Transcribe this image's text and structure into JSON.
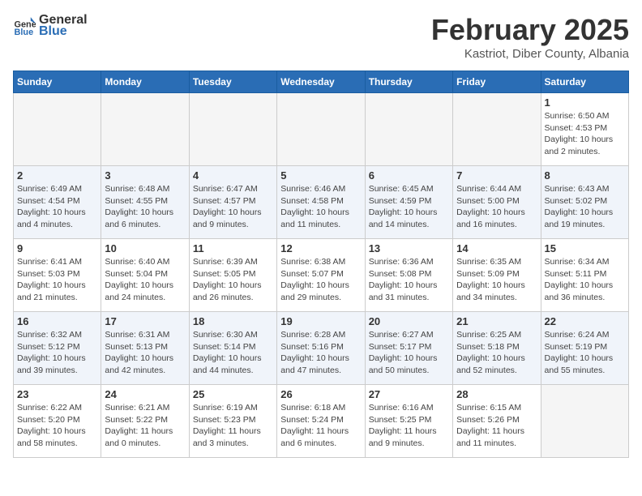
{
  "header": {
    "logo_general": "General",
    "logo_blue": "Blue",
    "month_title": "February 2025",
    "subtitle": "Kastriot, Diber County, Albania"
  },
  "weekdays": [
    "Sunday",
    "Monday",
    "Tuesday",
    "Wednesday",
    "Thursday",
    "Friday",
    "Saturday"
  ],
  "weeks": [
    [
      {
        "day": "",
        "info": ""
      },
      {
        "day": "",
        "info": ""
      },
      {
        "day": "",
        "info": ""
      },
      {
        "day": "",
        "info": ""
      },
      {
        "day": "",
        "info": ""
      },
      {
        "day": "",
        "info": ""
      },
      {
        "day": "1",
        "info": "Sunrise: 6:50 AM\nSunset: 4:53 PM\nDaylight: 10 hours and 2 minutes."
      }
    ],
    [
      {
        "day": "2",
        "info": "Sunrise: 6:49 AM\nSunset: 4:54 PM\nDaylight: 10 hours and 4 minutes."
      },
      {
        "day": "3",
        "info": "Sunrise: 6:48 AM\nSunset: 4:55 PM\nDaylight: 10 hours and 6 minutes."
      },
      {
        "day": "4",
        "info": "Sunrise: 6:47 AM\nSunset: 4:57 PM\nDaylight: 10 hours and 9 minutes."
      },
      {
        "day": "5",
        "info": "Sunrise: 6:46 AM\nSunset: 4:58 PM\nDaylight: 10 hours and 11 minutes."
      },
      {
        "day": "6",
        "info": "Sunrise: 6:45 AM\nSunset: 4:59 PM\nDaylight: 10 hours and 14 minutes."
      },
      {
        "day": "7",
        "info": "Sunrise: 6:44 AM\nSunset: 5:00 PM\nDaylight: 10 hours and 16 minutes."
      },
      {
        "day": "8",
        "info": "Sunrise: 6:43 AM\nSunset: 5:02 PM\nDaylight: 10 hours and 19 minutes."
      }
    ],
    [
      {
        "day": "9",
        "info": "Sunrise: 6:41 AM\nSunset: 5:03 PM\nDaylight: 10 hours and 21 minutes."
      },
      {
        "day": "10",
        "info": "Sunrise: 6:40 AM\nSunset: 5:04 PM\nDaylight: 10 hours and 24 minutes."
      },
      {
        "day": "11",
        "info": "Sunrise: 6:39 AM\nSunset: 5:05 PM\nDaylight: 10 hours and 26 minutes."
      },
      {
        "day": "12",
        "info": "Sunrise: 6:38 AM\nSunset: 5:07 PM\nDaylight: 10 hours and 29 minutes."
      },
      {
        "day": "13",
        "info": "Sunrise: 6:36 AM\nSunset: 5:08 PM\nDaylight: 10 hours and 31 minutes."
      },
      {
        "day": "14",
        "info": "Sunrise: 6:35 AM\nSunset: 5:09 PM\nDaylight: 10 hours and 34 minutes."
      },
      {
        "day": "15",
        "info": "Sunrise: 6:34 AM\nSunset: 5:11 PM\nDaylight: 10 hours and 36 minutes."
      }
    ],
    [
      {
        "day": "16",
        "info": "Sunrise: 6:32 AM\nSunset: 5:12 PM\nDaylight: 10 hours and 39 minutes."
      },
      {
        "day": "17",
        "info": "Sunrise: 6:31 AM\nSunset: 5:13 PM\nDaylight: 10 hours and 42 minutes."
      },
      {
        "day": "18",
        "info": "Sunrise: 6:30 AM\nSunset: 5:14 PM\nDaylight: 10 hours and 44 minutes."
      },
      {
        "day": "19",
        "info": "Sunrise: 6:28 AM\nSunset: 5:16 PM\nDaylight: 10 hours and 47 minutes."
      },
      {
        "day": "20",
        "info": "Sunrise: 6:27 AM\nSunset: 5:17 PM\nDaylight: 10 hours and 50 minutes."
      },
      {
        "day": "21",
        "info": "Sunrise: 6:25 AM\nSunset: 5:18 PM\nDaylight: 10 hours and 52 minutes."
      },
      {
        "day": "22",
        "info": "Sunrise: 6:24 AM\nSunset: 5:19 PM\nDaylight: 10 hours and 55 minutes."
      }
    ],
    [
      {
        "day": "23",
        "info": "Sunrise: 6:22 AM\nSunset: 5:20 PM\nDaylight: 10 hours and 58 minutes."
      },
      {
        "day": "24",
        "info": "Sunrise: 6:21 AM\nSunset: 5:22 PM\nDaylight: 11 hours and 0 minutes."
      },
      {
        "day": "25",
        "info": "Sunrise: 6:19 AM\nSunset: 5:23 PM\nDaylight: 11 hours and 3 minutes."
      },
      {
        "day": "26",
        "info": "Sunrise: 6:18 AM\nSunset: 5:24 PM\nDaylight: 11 hours and 6 minutes."
      },
      {
        "day": "27",
        "info": "Sunrise: 6:16 AM\nSunset: 5:25 PM\nDaylight: 11 hours and 9 minutes."
      },
      {
        "day": "28",
        "info": "Sunrise: 6:15 AM\nSunset: 5:26 PM\nDaylight: 11 hours and 11 minutes."
      },
      {
        "day": "",
        "info": ""
      }
    ]
  ]
}
